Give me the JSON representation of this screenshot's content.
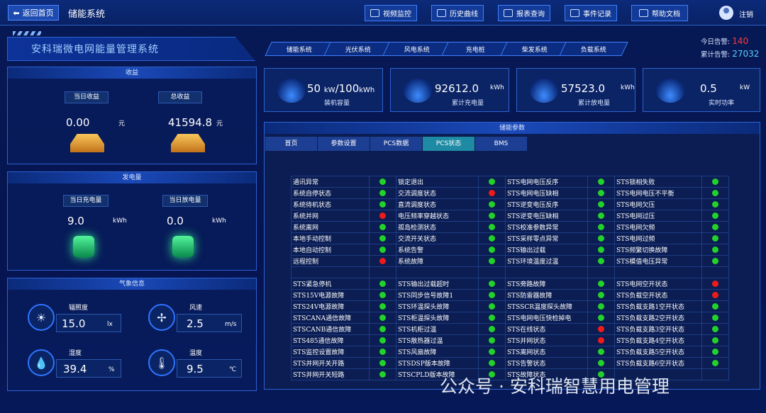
{
  "topbar": {
    "back": "返回首页",
    "system_name": "储能系统",
    "nav": [
      {
        "label": "视频监控",
        "icon": "video-icon"
      },
      {
        "label": "历史曲线",
        "icon": "chart-icon"
      },
      {
        "label": "报表查询",
        "icon": "search-icon"
      },
      {
        "label": "事件记录",
        "icon": "document-icon"
      },
      {
        "label": "帮助文档",
        "icon": "help-icon"
      }
    ],
    "logout": "注销"
  },
  "app_title": "安科瑞微电网能量管理系统",
  "sys_tabs": [
    "储能系统",
    "光伏系统",
    "风电系统",
    "充电桩",
    "柴发系统",
    "负载系统"
  ],
  "alarms": {
    "today_label": "今日告警:",
    "today_value": "140",
    "total_label": "累计告警:",
    "total_value": "27032"
  },
  "income": {
    "title": "收益",
    "today_label": "当日收益",
    "total_label": "总收益",
    "today_value": "0.00",
    "total_value": "41594.8",
    "unit": "元"
  },
  "power": {
    "title": "发电量",
    "charge_label": "当日充电量",
    "discharge_label": "当日放电量",
    "charge_value": "9.0",
    "discharge_value": "0.0",
    "unit": "kWh"
  },
  "weather": {
    "title": "气象信息",
    "items": [
      {
        "label": "辐照度",
        "value": "15.0",
        "unit": "lx",
        "icon": "sun-icon"
      },
      {
        "label": "风速",
        "value": "2.5",
        "unit": "m/s",
        "icon": "fan-icon"
      },
      {
        "label": "湿度",
        "value": "39.4",
        "unit": "%",
        "icon": "humidity-icon"
      },
      {
        "label": "温度",
        "value": "9.5",
        "unit": "℃",
        "icon": "thermometer-icon"
      }
    ]
  },
  "cards": [
    {
      "value": "50",
      "unit_a": "kW",
      "sep": "/100",
      "unit_b": "kWh",
      "label": "装机容量",
      "icon": "battery-icon"
    },
    {
      "value": "92612.0",
      "unit_b": "kWh",
      "label": "累计充电量",
      "icon": "gauge-icon"
    },
    {
      "value": "57523.0",
      "unit_b": "kWh",
      "label": "累计放电量",
      "icon": "gauge-icon"
    },
    {
      "value": "0.5",
      "unit_b": "kW",
      "label": "实时功率",
      "icon": "pulse-icon"
    }
  ],
  "params": {
    "title": "储能参数",
    "tabs": [
      "首页",
      "参数设置",
      "PCS数据",
      "PCS状态",
      "BMS"
    ],
    "active_tab": "PCS状态",
    "rows": [
      [
        "通讯异常",
        "green",
        "锁定退出",
        "green",
        "STS电网电压反序",
        "green",
        "STS锁相失败",
        "green"
      ],
      [
        "系统自停状态",
        "green",
        "交流调度状态",
        "red",
        "STS电网电压缺相",
        "green",
        "STS电网电压不平衡",
        "green"
      ],
      [
        "系统待机状态",
        "green",
        "直流调度状态",
        "green",
        "STS逆变电压反序",
        "green",
        "STS电网欠压",
        "green"
      ],
      [
        "系统并网",
        "red",
        "电压频率穿越状态",
        "green",
        "STS逆变电压缺相",
        "green",
        "STS电网过压",
        "green"
      ],
      [
        "系统离网",
        "green",
        "孤岛检测状态",
        "green",
        "STS校准参数异常",
        "green",
        "STS电网欠频",
        "green"
      ],
      [
        "本地手动控制",
        "green",
        "交流开关状态",
        "green",
        "STS采样零点异常",
        "green",
        "STS电网过频",
        "green"
      ],
      [
        "本地自动控制",
        "green",
        "系统告警",
        "green",
        "STS输出过载",
        "green",
        "STS频繁切换故障",
        "green"
      ],
      [
        "远程控制",
        "red",
        "系统故障",
        "green",
        "STS环境温度过温",
        "green",
        "STS模值电压异常",
        "green"
      ],
      [
        "",
        "",
        "",
        "",
        "",
        "",
        "",
        ""
      ],
      [
        "STS紧急停机",
        "green",
        "STS输出过载超时",
        "green",
        "STS旁路故障",
        "green",
        "STS电网空开状态",
        "red"
      ],
      [
        "STS15V电源故障",
        "green",
        "STS同步信号故障1",
        "green",
        "STS防雷器故障",
        "green",
        "STS负载空开状态",
        "red"
      ],
      [
        "STS24V电源故障",
        "green",
        "STS环温探头故障",
        "green",
        "STSSCR温度探头故障",
        "green",
        "STS负载支路1空开状态",
        "green"
      ],
      [
        "STSCANA通信故障",
        "green",
        "STS柜温探头故障",
        "green",
        "STS电网电压快检掉电",
        "green",
        "STS负载支路2空开状态",
        "green"
      ],
      [
        "STSCANB通信故障",
        "green",
        "STS机柜过温",
        "green",
        "STS在线状态",
        "red",
        "STS负载支路3空开状态",
        "green"
      ],
      [
        "STS485通信故障",
        "green",
        "STS散热器过温",
        "green",
        "STS并网状态",
        "red",
        "STS负载支路4空开状态",
        "green"
      ],
      [
        "STS监控设置故障",
        "green",
        "STS风扇故障",
        "green",
        "STS离网状态",
        "green",
        "STS负载支路5空开状态",
        "green"
      ],
      [
        "STS并网开关开路",
        "green",
        "STSDSP版本故障",
        "green",
        "STS告警状态",
        "green",
        "STS负载支路6空开状态",
        "green"
      ],
      [
        "STS并网开关短路",
        "green",
        "STSCPLD版本故障",
        "green",
        "STS故障状态",
        "green",
        "",
        ""
      ]
    ]
  },
  "watermark": "公众号 · 安科瑞智慧用电管理"
}
